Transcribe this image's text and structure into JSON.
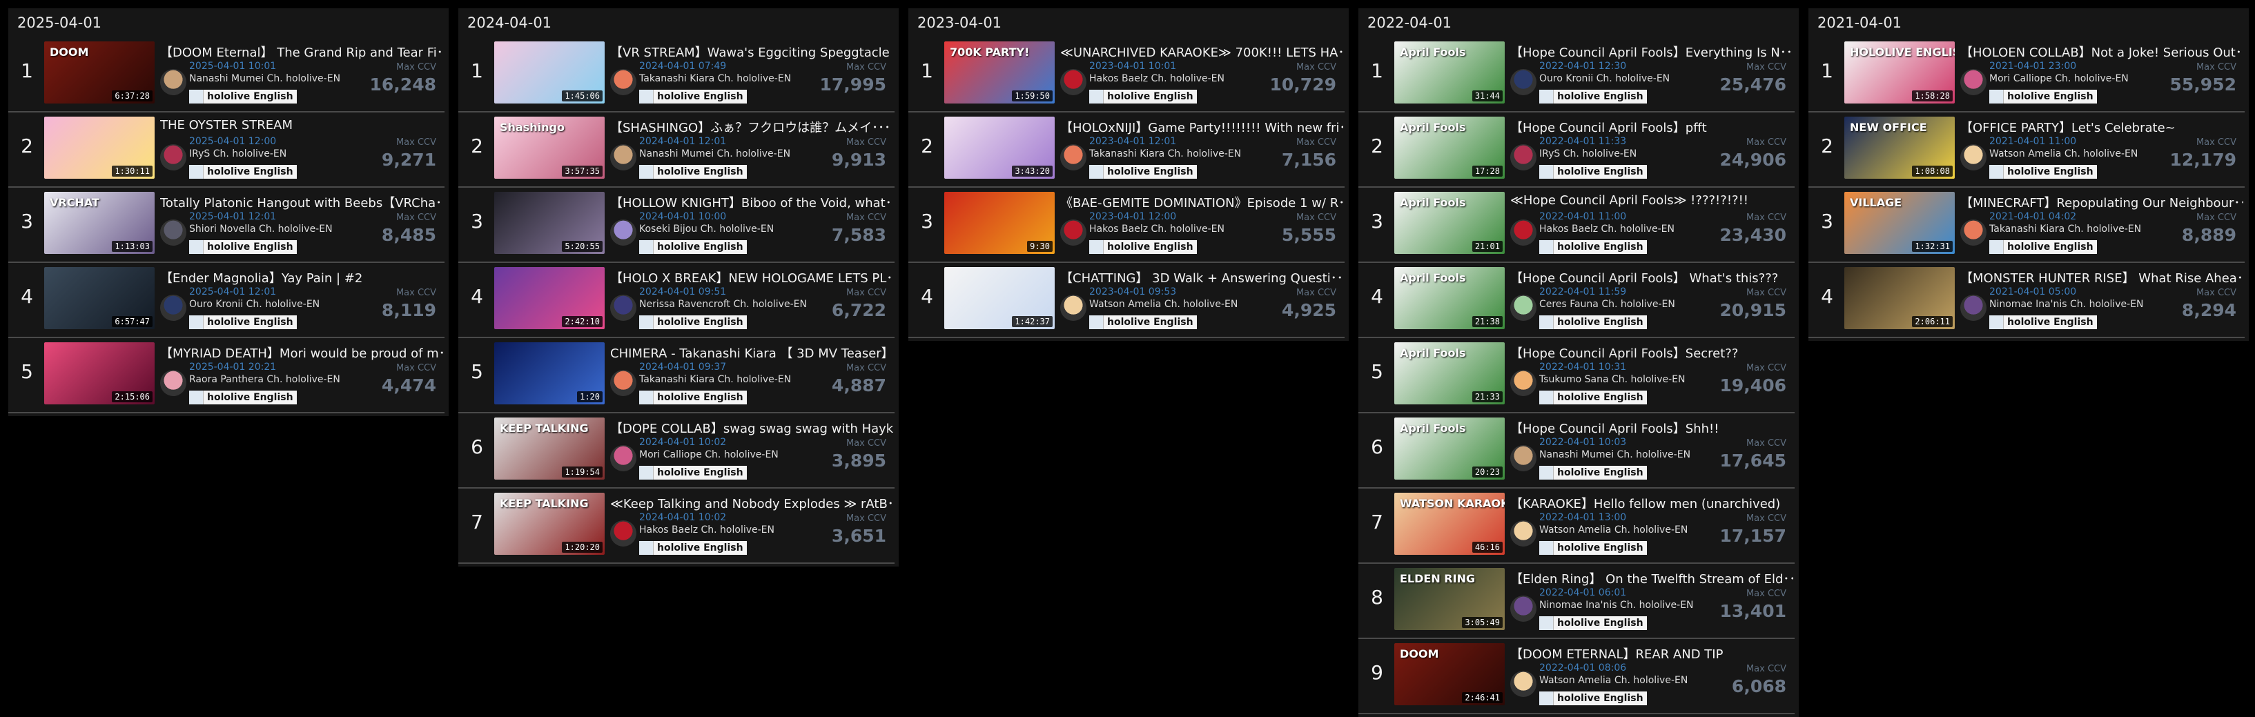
{
  "max_ccv_label": "Max CCV",
  "org_label": "hololive English",
  "columns": [
    {
      "date": "2025-04-01",
      "rows": [
        {
          "rank": "1",
          "title": "【DOOM Eternal】 The Grand Rip and Tear Fi･･･",
          "date": "2025-04-01 10:01",
          "channel": "Nanashi Mumei Ch. hololive-EN",
          "ccv": "16,248",
          "duration": "6:37:28",
          "thumb_text": "DOOM",
          "thumb_colors": [
            "#7a1a10",
            "#2a0805"
          ],
          "avatar_color": "#c9a27a"
        },
        {
          "rank": "2",
          "title": "THE OYSTER STREAM",
          "date": "2025-04-01 12:00",
          "channel": "IRyS Ch. hololive-EN",
          "ccv": "9,271",
          "duration": "1:30:11",
          "thumb_text": "",
          "thumb_colors": [
            "#f5b6d8",
            "#fbe27a"
          ],
          "avatar_color": "#b03050"
        },
        {
          "rank": "3",
          "title": "Totally Platonic Hangout with Beebs【VRCha･･･",
          "date": "2025-04-01 12:01",
          "channel": "Shiori Novella Ch. hololive-EN",
          "ccv": "8,485",
          "duration": "1:13:03",
          "thumb_text": "VRCHAT",
          "thumb_colors": [
            "#e8e8f0",
            "#6a5a8a"
          ],
          "avatar_color": "#5a5a6a"
        },
        {
          "rank": "4",
          "title": "【Ender Magnolia】Yay Pain | #2",
          "date": "2025-04-01 12:01",
          "channel": "Ouro Kronii Ch. hololive-EN",
          "ccv": "8,119",
          "duration": "6:57:47",
          "thumb_text": "",
          "thumb_colors": [
            "#3a4a5a",
            "#121a24"
          ],
          "avatar_color": "#2a3a6a"
        },
        {
          "rank": "5",
          "title": "【MYRIAD DEATH】Mori would be proud of m･･･",
          "date": "2025-04-01 20:21",
          "channel": "Raora Panthera Ch. hololive-EN",
          "ccv": "4,474",
          "duration": "2:15:06",
          "thumb_text": "",
          "thumb_colors": [
            "#e84a7a",
            "#5a0a2a"
          ],
          "avatar_color": "#e8a0b0"
        }
      ]
    },
    {
      "date": "2024-04-01",
      "rows": [
        {
          "rank": "1",
          "title": "【VR STREAM】Wawa's Eggciting Speggtacle ･･･",
          "date": "2024-04-01 07:49",
          "channel": "Takanashi Kiara Ch. hololive-EN",
          "ccv": "17,995",
          "duration": "1:45:06",
          "thumb_text": "",
          "thumb_colors": [
            "#f0c8e0",
            "#8ad0f0"
          ],
          "avatar_color": "#e87a5a"
        },
        {
          "rank": "2",
          "title": "【SHASHINGO】ふぁ？フクロウは誰？ムメイ･･･",
          "date": "2024-04-01 12:01",
          "channel": "Nanashi Mumei Ch. hololive-EN",
          "ccv": "9,913",
          "duration": "3:57:35",
          "thumb_text": "Shashingo",
          "thumb_colors": [
            "#f8d0e0",
            "#c05a7a"
          ],
          "avatar_color": "#c9a27a"
        },
        {
          "rank": "3",
          "title": "【HOLLOW KNIGHT】Biboo of the Void, what･･･",
          "date": "2024-04-01 10:00",
          "channel": "Koseki Bijou Ch. hololive-EN",
          "ccv": "7,583",
          "duration": "5:20:55",
          "thumb_text": "",
          "thumb_colors": [
            "#202028",
            "#8a7aa0"
          ],
          "avatar_color": "#9a8ad0"
        },
        {
          "rank": "4",
          "title": "【HOLO X BREAK】NEW HOLOGAME LETS PL･･･",
          "date": "2024-04-01 09:51",
          "channel": "Nerissa Ravencroft Ch. hololive-EN",
          "ccv": "6,722",
          "duration": "2:42:10",
          "thumb_text": "",
          "thumb_colors": [
            "#6a3aa0",
            "#e84a8a"
          ],
          "avatar_color": "#3a3a7a"
        },
        {
          "rank": "5",
          "title": "CHIMERA - Takanashi Kiara 【 3D MV Teaser】",
          "date": "2024-04-01 09:37",
          "channel": "Takanashi Kiara Ch. hololive-EN",
          "ccv": "4,887",
          "duration": "1:20",
          "thumb_text": "",
          "thumb_colors": [
            "#0a1a5a",
            "#3a6ad0"
          ],
          "avatar_color": "#e87a5a"
        },
        {
          "rank": "6",
          "title": "【DOPE COLLAB】swag swag swag with Hayk･･･",
          "date": "2024-04-01 10:02",
          "channel": "Mori Calliope Ch. hololive-EN",
          "ccv": "3,895",
          "duration": "1:19:54",
          "thumb_text": "KEEP TALKING",
          "thumb_colors": [
            "#e0e0e0",
            "#7a2a2a"
          ],
          "avatar_color": "#d05a8a"
        },
        {
          "rank": "7",
          "title": "≪Keep Talking and Nobody Explodes ≫ rAtB･･･",
          "date": "2024-04-01 10:02",
          "channel": "Hakos Baelz Ch. hololive-EN",
          "ccv": "3,651",
          "duration": "1:20:20",
          "thumb_text": "KEEP TALKING",
          "thumb_colors": [
            "#e0e0e0",
            "#8a1a1a"
          ],
          "avatar_color": "#c01a2a"
        }
      ]
    },
    {
      "date": "2023-04-01",
      "rows": [
        {
          "rank": "1",
          "title": "≪UNARCHIVED KARAOKE≫ 700K!!! LETS HA･･･",
          "date": "2023-04-01 10:01",
          "channel": "Hakos Baelz Ch. hololive-EN",
          "ccv": "10,729",
          "duration": "1:59:50",
          "thumb_text": "700K PARTY!",
          "thumb_colors": [
            "#e83a3a",
            "#3a7ad0"
          ],
          "avatar_color": "#c01a2a"
        },
        {
          "rank": "2",
          "title": "【HOLOxNIJI】Game Party!!!!!!!! With new fri･･･",
          "date": "2023-04-01 12:01",
          "channel": "Takanashi Kiara Ch. hololive-EN",
          "ccv": "7,156",
          "duration": "3:43:20",
          "thumb_text": "",
          "thumb_colors": [
            "#f0e0f0",
            "#a07ad0"
          ],
          "avatar_color": "#e87a5a"
        },
        {
          "rank": "3",
          "title": "《BAE-GEMITE DOMINATION》Episode 1 w/ R･･･",
          "date": "2023-04-01 12:00",
          "channel": "Hakos Baelz Ch. hololive-EN",
          "ccv": "5,555",
          "duration": "9:30",
          "thumb_text": "",
          "thumb_colors": [
            "#d02a1a",
            "#f0a01a"
          ],
          "avatar_color": "#c01a2a"
        },
        {
          "rank": "4",
          "title": "【CHATTING】 3D Walk + Answering Questi･･･",
          "date": "2023-04-01 09:53",
          "channel": "Watson Amelia Ch. hololive-EN",
          "ccv": "4,925",
          "duration": "1:42:37",
          "thumb_text": "",
          "thumb_colors": [
            "#f4f4f4",
            "#c8d8f0"
          ],
          "avatar_color": "#f0d0a0"
        }
      ]
    },
    {
      "date": "2022-04-01",
      "rows": [
        {
          "rank": "1",
          "title": "【Hope Council April Fools】Everything Is N･･･",
          "date": "2022-04-01 12:30",
          "channel": "Ouro Kronii Ch. hololive-EN",
          "ccv": "25,476",
          "duration": "31:44",
          "thumb_text": "April Fools",
          "thumb_colors": [
            "#f4f4f4",
            "#3a8a3a"
          ],
          "avatar_color": "#2a3a6a"
        },
        {
          "rank": "2",
          "title": "【Hope Council April Fools】pfft",
          "date": "2022-04-01 11:33",
          "channel": "IRyS Ch. hololive-EN",
          "ccv": "24,906",
          "duration": "17:28",
          "thumb_text": "April Fools",
          "thumb_colors": [
            "#f4f4f4",
            "#3a8a3a"
          ],
          "avatar_color": "#b03050"
        },
        {
          "rank": "3",
          "title": "≪Hope Council April Fools≫ !???!?!?!!",
          "date": "2022-04-01 11:00",
          "channel": "Hakos Baelz Ch. hololive-EN",
          "ccv": "23,430",
          "duration": "21:01",
          "thumb_text": "April Fools",
          "thumb_colors": [
            "#f4f4f4",
            "#3a8a3a"
          ],
          "avatar_color": "#c01a2a"
        },
        {
          "rank": "4",
          "title": "【Hope Council April Fools】 What's this???",
          "date": "2022-04-01 11:59",
          "channel": "Ceres Fauna Ch. hololive-EN",
          "ccv": "20,915",
          "duration": "21:38",
          "thumb_text": "April Fools",
          "thumb_colors": [
            "#f4f4f4",
            "#3a8a3a"
          ],
          "avatar_color": "#a0d0a0"
        },
        {
          "rank": "5",
          "title": "【Hope Council April Fools】Secret??",
          "date": "2022-04-01 10:31",
          "channel": "Tsukumo Sana Ch. hololive-EN",
          "ccv": "19,406",
          "duration": "21:33",
          "thumb_text": "April Fools",
          "thumb_colors": [
            "#f4f4f4",
            "#3a8a3a"
          ],
          "avatar_color": "#f0b070"
        },
        {
          "rank": "6",
          "title": "【Hope Council April Fools】Shh!!",
          "date": "2022-04-01 10:03",
          "channel": "Nanashi Mumei Ch. hololive-EN",
          "ccv": "17,645",
          "duration": "20:23",
          "thumb_text": "April Fools",
          "thumb_colors": [
            "#f4f4f4",
            "#3a8a3a"
          ],
          "avatar_color": "#c9a27a"
        },
        {
          "rank": "7",
          "title": "【KARAOKE】Hello fellow men (unarchived)",
          "date": "2022-04-01 13:00",
          "channel": "Watson Amelia Ch. hololive-EN",
          "ccv": "17,157",
          "duration": "46:16",
          "thumb_text": "WATSON KARAOKE",
          "thumb_colors": [
            "#f0d0a0",
            "#d03a2a"
          ],
          "avatar_color": "#f0d0a0"
        },
        {
          "rank": "8",
          "title": "【Elden Ring】 On the Twelfth Stream of Eld･･･",
          "date": "2022-04-01 06:01",
          "channel": "Ninomae Ina'nis Ch. hololive-EN",
          "ccv": "13,401",
          "duration": "3:05:49",
          "thumb_text": "ELDEN RING",
          "thumb_colors": [
            "#2a3a2a",
            "#8a7a4a"
          ],
          "avatar_color": "#6a4a8a"
        },
        {
          "rank": "9",
          "title": "【DOOM ETERNAL】REAR AND TIP",
          "date": "2022-04-01 08:06",
          "channel": "Watson Amelia Ch. hololive-EN",
          "ccv": "6,068",
          "duration": "2:46:41",
          "thumb_text": "DOOM",
          "thumb_colors": [
            "#7a1a10",
            "#2a0805"
          ],
          "avatar_color": "#f0d0a0"
        }
      ]
    },
    {
      "date": "2021-04-01",
      "rows": [
        {
          "rank": "1",
          "title": "【HOLOEN COLLAB】Not a Joke! Serious Out･･･",
          "date": "2021-04-01 23:00",
          "channel": "Mori Calliope Ch. hololive-EN",
          "ccv": "55,952",
          "duration": "1:58:28",
          "thumb_text": "HOLOLIVE ENGLISH",
          "thumb_colors": [
            "#f4f4f4",
            "#d03a6a"
          ],
          "avatar_color": "#d05a8a"
        },
        {
          "rank": "2",
          "title": "【OFFICE PARTY】Let's Celebrate~",
          "date": "2021-04-01 11:00",
          "channel": "Watson Amelia Ch. hololive-EN",
          "ccv": "12,179",
          "duration": "1:08:08",
          "thumb_text": "NEW OFFICE",
          "thumb_colors": [
            "#1a2a5a",
            "#f0d040"
          ],
          "avatar_color": "#f0d0a0"
        },
        {
          "rank": "3",
          "title": "【MINECRAFT】Repopulating Our Neighbour･･･",
          "date": "2021-04-01 04:02",
          "channel": "Takanashi Kiara Ch. hololive-EN",
          "ccv": "8,889",
          "duration": "1:32:31",
          "thumb_text": "VILLAGE",
          "thumb_colors": [
            "#f08a3a",
            "#3a8ad0"
          ],
          "avatar_color": "#e87a5a"
        },
        {
          "rank": "4",
          "title": "【MONSTER HUNTER RISE】 What Rise Ahea･･･",
          "date": "2021-04-01 05:00",
          "channel": "Ninomae Ina'nis Ch. hololive-EN",
          "ccv": "8,294",
          "duration": "2:06:11",
          "thumb_text": "",
          "thumb_colors": [
            "#3a3020",
            "#c0a060"
          ],
          "avatar_color": "#6a4a8a"
        }
      ]
    }
  ]
}
